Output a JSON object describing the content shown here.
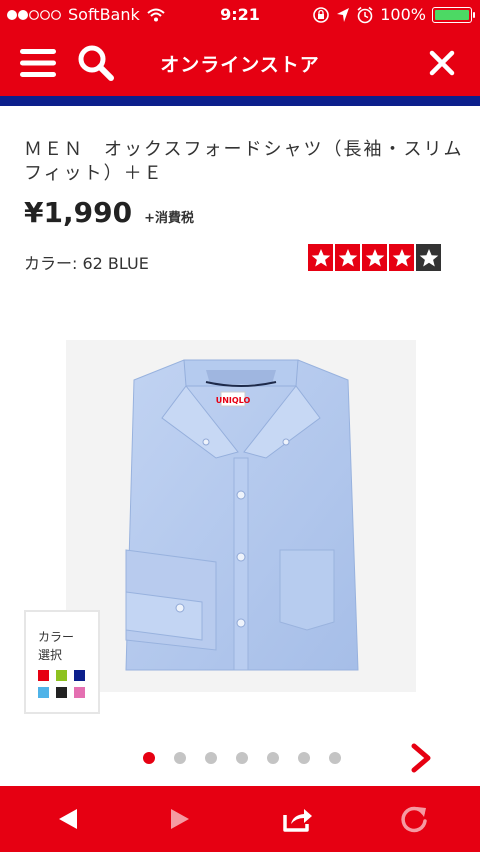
{
  "status_bar": {
    "carrier": "SoftBank",
    "time": "9:21",
    "battery": "100%",
    "signal_dots": [
      true,
      true,
      false,
      false,
      false
    ]
  },
  "nav": {
    "title": "オンラインストア",
    "menu_icon": "hamburger-icon",
    "search_icon": "search-icon",
    "close_icon": "close-icon"
  },
  "product": {
    "title": "ＭＥＮ　オックスフォードシャツ（長袖・スリムフィット）＋Ｅ",
    "price": "¥1,990",
    "tax_label": "+消費税",
    "color_label": "カラー: 62 BLUE",
    "rating": 4,
    "rating_max": 5,
    "tag": "UNIQLO"
  },
  "color_panel": {
    "label_line1": "カラー",
    "label_line2": "選択",
    "swatches": [
      "#e60012",
      "#8dc21f",
      "#0c1f8c",
      "#4fb3e8",
      "#222222",
      "#e46fb1"
    ]
  },
  "gallery": {
    "pages": 7,
    "current": 1
  },
  "colors": {
    "brand_red": "#e60012",
    "stripe_blue": "#0c1f8c",
    "shirt_blue": "#b3c9ee"
  },
  "toolbar": {
    "items": [
      "back-icon",
      "forward-icon",
      "share-icon",
      "reload-icon"
    ]
  }
}
